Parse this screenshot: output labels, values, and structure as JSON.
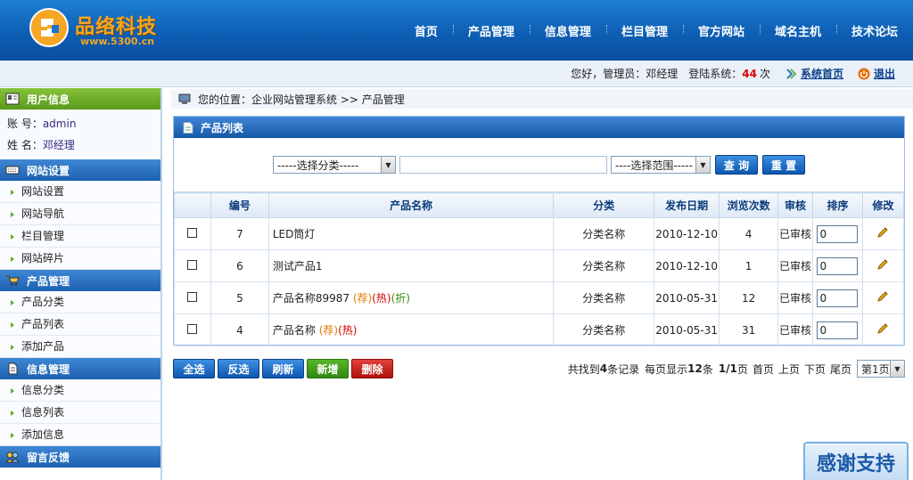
{
  "logo": {
    "text": "品络科技",
    "url": "www.5300.cn"
  },
  "nav": [
    "首页",
    "产品管理",
    "信息管理",
    "栏目管理",
    "官方网站",
    "域名主机",
    "技术论坛"
  ],
  "userbar": {
    "greeting": "您好，管理员：邓经理",
    "login_prefix": "登陆系统：",
    "login_count": "44",
    "login_suffix": "次",
    "home_link": "系统首页",
    "logout_link": "退出"
  },
  "sidebar": {
    "user_info_title": "用户信息",
    "account_label": "账 号：",
    "account_value": "admin",
    "name_label": "姓 名：",
    "name_value": "邓经理",
    "groups": [
      {
        "title": "网站设置",
        "items": [
          "网站设置",
          "网站导航",
          "栏目管理",
          "网站碎片"
        ]
      },
      {
        "title": "产品管理",
        "items": [
          "产品分类",
          "产品列表",
          "添加产品"
        ]
      },
      {
        "title": "信息管理",
        "items": [
          "信息分类",
          "信息列表",
          "添加信息"
        ]
      },
      {
        "title": "留言反馈",
        "items": []
      }
    ]
  },
  "breadcrumb": "您的位置：企业网站管理系统 >> 产品管理",
  "panel": {
    "title": "产品列表"
  },
  "search": {
    "category_select": "-----选择分类-----",
    "range_select": "----选择范围-----",
    "query_button": "查 询",
    "reset_button": "重 置"
  },
  "table": {
    "headers": [
      "",
      "编号",
      "产品名称",
      "分类",
      "发布日期",
      "浏览次数",
      "审核",
      "排序",
      "修改"
    ],
    "rows": [
      {
        "id": "7",
        "name": "LED筒灯",
        "tags": [],
        "category": "分类名称",
        "date": "2010-12-10",
        "views": "4",
        "audit": "已审核",
        "sort": "0"
      },
      {
        "id": "6",
        "name": "测试产品1",
        "tags": [],
        "category": "分类名称",
        "date": "2010-12-10",
        "views": "1",
        "audit": "已审核",
        "sort": "0"
      },
      {
        "id": "5",
        "name": "产品名称89987",
        "tags": [
          "(荐)",
          "(热)",
          "(折)"
        ],
        "category": "分类名称",
        "date": "2010-05-31",
        "views": "12",
        "audit": "已审核",
        "sort": "0"
      },
      {
        "id": "4",
        "name": "产品名称",
        "tags": [
          "(荐)",
          "(热)"
        ],
        "category": "分类名称",
        "date": "2010-05-31",
        "views": "31",
        "audit": "已审核",
        "sort": "0"
      }
    ]
  },
  "actions": [
    "全选",
    "反选",
    "刷新",
    "新增",
    "删除"
  ],
  "pager": {
    "found_prefix": "共找到",
    "found_count": "4",
    "found_suffix": "条记录",
    "per_page_prefix": "每页显示",
    "per_page": "12",
    "per_page_suffix": "条",
    "page_info": "1/1",
    "page_word": "页",
    "first": "首页",
    "prev": "上页",
    "next": "下页",
    "last": "尾页",
    "page_select": "第1页"
  },
  "thanks": "感谢支持",
  "colors": {
    "header_blue": "#0d5fb5",
    "green_head": "#6aa82a",
    "count_red": "#dd0000"
  }
}
